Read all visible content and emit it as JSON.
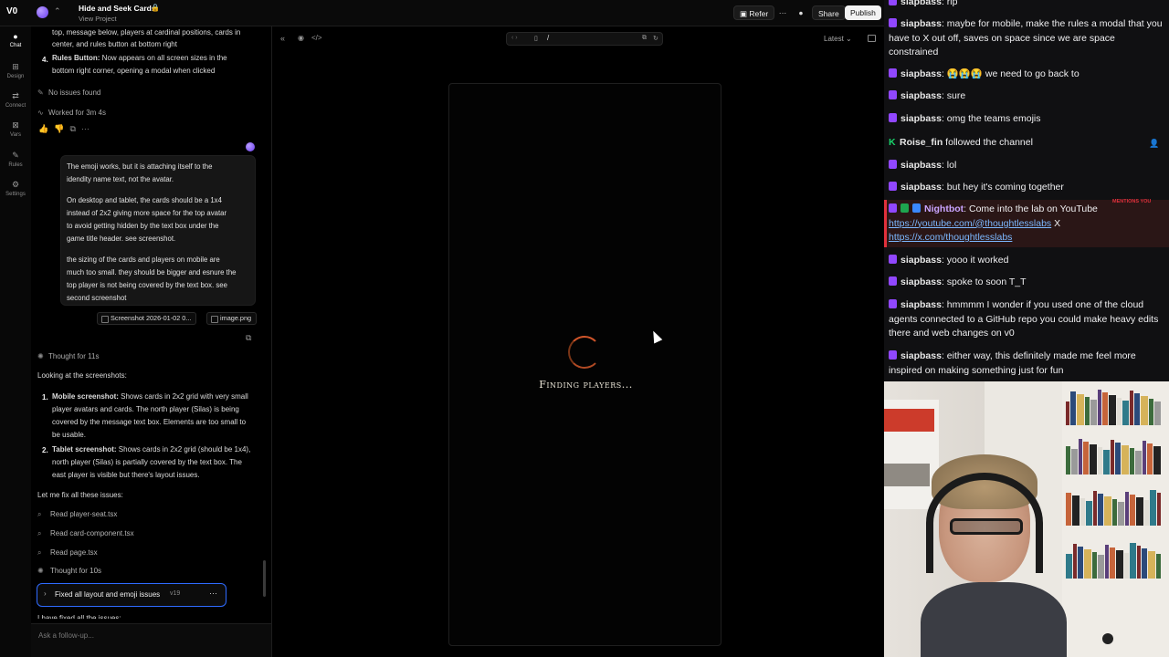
{
  "topbar": {
    "logo": "V0",
    "project_name": "Hide and Seek Cards",
    "project_sub": "View Project",
    "refer": "Refer",
    "share": "Share",
    "publish": "Publish"
  },
  "rail": [
    {
      "label": "Chat",
      "icon": "chat-icon"
    },
    {
      "label": "Design",
      "icon": "design-icon"
    },
    {
      "label": "Connect",
      "icon": "connect-icon"
    },
    {
      "label": "Vars",
      "icon": "vars-icon"
    },
    {
      "label": "Rules",
      "icon": "rules-icon"
    },
    {
      "label": "Settings",
      "icon": "settings-icon"
    }
  ],
  "chat": {
    "prev_line1": "top, message below, players at cardinal positions, cards in",
    "prev_line2": "center, and rules button at bottom right",
    "item4_num": "4.",
    "item4_title": "Rules Button:",
    "item4_text1": "Now appears on all screen sizes in the",
    "item4_text2": "bottom right corner, opening a modal when clicked",
    "no_issues": "No issues found",
    "worked_for": "Worked for 3m 4s",
    "user_msg_1a": "The emoji works, but it is attaching itself to the",
    "user_msg_1b": "idendity name text, not the avatar.",
    "user_msg_2a": "On desktop and tablet, the cards should be a 1x4",
    "user_msg_2b": "instead of 2x2 giving more space for the top avatar",
    "user_msg_2c": "to avoid getting hidden by the text box under the",
    "user_msg_2d": "game title header. see screenshot.",
    "user_msg_3a": "the sizing of the cards and players on mobile are",
    "user_msg_3b": "much too small. they should be bigger and esnure the",
    "user_msg_3c": "top player is not being covered by the text box. see",
    "user_msg_3d": "second screenshot",
    "attachment_1": "Screenshot 2026-01-02 0...",
    "attachment_2": "image.png",
    "thought_1": "Thought for 11s",
    "looking": "Looking at the screenshots:",
    "s1_num": "1.",
    "s1_title": "Mobile screenshot:",
    "s1_a": "Shows cards in 2x2 grid with very small",
    "s1_b": "player avatars and cards. The north player (Silas) is being",
    "s1_c": "covered by the message text box. Elements are too small to",
    "s1_d": "be usable.",
    "s2_num": "2.",
    "s2_title": "Tablet screenshot:",
    "s2_a": "Shows cards in 2x2 grid (should be 1x4),",
    "s2_b": "north player (Silas) is partially covered by the text box. The",
    "s2_c": "east player is visible but there's layout issues.",
    "let_me_fix": "Let me fix all these issues:",
    "read_1": "Read player-seat.tsx",
    "read_2": "Read card-component.tsx",
    "read_3": "Read page.tsx",
    "thought_2": "Thought for 10s",
    "version_label": "Fixed all layout and emoji issues",
    "version_tag": "v19",
    "cut_line": "I have fixed all the issues:",
    "followup_placeholder": "Ask a follow-up..."
  },
  "preview": {
    "url_path": "/",
    "latest": "Latest",
    "loading_text": "Finding players..."
  },
  "twitch": {
    "messages": [
      {
        "user": "siapbass",
        "text": ": rip"
      },
      {
        "user": "siapbass",
        "text": ": maybe for mobile, make the rules a modal that you have to X out off, saves on space since we are space constrained"
      },
      {
        "user": "siapbass",
        "text": ": 😭😭😭 we need to go back to"
      },
      {
        "user": "siapbass",
        "text": ": sure"
      },
      {
        "user": "siapbass",
        "text": ": omg the teams emojis"
      },
      {
        "user": "Roise_fin",
        "text": " followed the channel"
      },
      {
        "user": "siapbass",
        "text": ": lol"
      },
      {
        "user": "siapbass",
        "text": ": but hey it's coming together"
      },
      {
        "user": "Nightbot",
        "text": ": Come into the lab on YouTube"
      },
      {
        "user": "siapbass",
        "text": ": yooo it worked"
      },
      {
        "user": "siapbass",
        "text": ": spoke to soon T_T"
      },
      {
        "user": "siapbass",
        "text": ": hmmmm I wonder if you used one of the cloud agents connected to a GitHub repo you could make heavy edits there and web changes on v0"
      },
      {
        "user": "siapbass",
        "text": ": either way, this definitely made me feel more inspired on making something just for fun"
      }
    ],
    "link_youtube": "https://youtube.com/@thoughtlesslabs",
    "link_sep": " X",
    "link_x": "https://x.com/thoughtlesslabs",
    "mentions_you": "MENTIONS YOU"
  },
  "colors": {
    "accent_blue": "#2f6bff",
    "twitch_purple": "#9147ff",
    "spinner_orange": "#d0552a",
    "mention_red": "#e0303b"
  }
}
